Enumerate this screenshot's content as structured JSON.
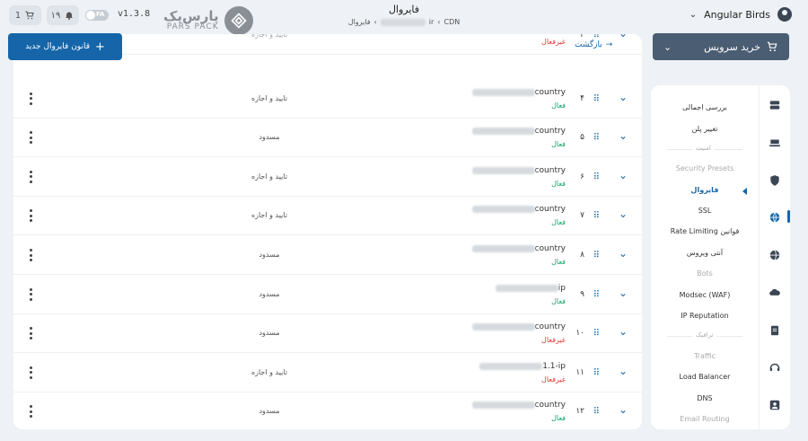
{
  "topbar": {
    "cart_count": "1",
    "notifications_count": "۱۹",
    "lang_label": "FA",
    "version": "v1.3.8",
    "brand_fa": "پارس‌پک",
    "brand_en": "PARS PACK",
    "page_title": "فایروال",
    "breadcrumb": {
      "cdn": "CDN",
      "domain_suffix": "ir",
      "current": "فایروال"
    },
    "account_name": "Angular Birds"
  },
  "actions": {
    "add_rule_label": "قانون فایروال جدید",
    "back_label": "بازگشت",
    "buy_service_label": "خرید سرویس"
  },
  "rules": [
    {
      "num": "۳",
      "name_suffix": "allow-Czech Republic country",
      "status": "غیرفعال",
      "status_type": "inactive",
      "action": "تایید و اجازه",
      "faded": true
    },
    {
      "num": "۴",
      "name_suffix": "country",
      "status": "فعال",
      "status_type": "active",
      "action": "تایید و اجازه"
    },
    {
      "num": "۵",
      "name_suffix": "country",
      "status": "فعال",
      "status_type": "active",
      "action": "مسدود"
    },
    {
      "num": "۶",
      "name_suffix": "country",
      "status": "فعال",
      "status_type": "active",
      "action": "تایید و اجازه"
    },
    {
      "num": "۷",
      "name_suffix": "country",
      "status": "فعال",
      "status_type": "active",
      "action": "تایید و اجازه"
    },
    {
      "num": "۸",
      "name_suffix": "country",
      "status": "فعال",
      "status_type": "active",
      "action": "مسدود"
    },
    {
      "num": "۹",
      "name_suffix": "ip",
      "status": "فعال",
      "status_type": "active",
      "action": "مسدود"
    },
    {
      "num": "۱۰",
      "name_suffix": "country",
      "status": "غیرفعال",
      "status_type": "inactive",
      "action": "مسدود"
    },
    {
      "num": "۱۱",
      "name_suffix": "1.1-ip",
      "status": "غیرفعال",
      "status_type": "inactive",
      "action": "تایید و اجازه"
    },
    {
      "num": "۱۲",
      "name_suffix": "country",
      "status": "فعال",
      "status_type": "active",
      "action": "مسدود"
    }
  ],
  "menu": {
    "overview": "بررسی اجمالی",
    "change_plan": "تغییر پلن",
    "security_section": "امنیت",
    "security_presets": "Security Presets",
    "firewall": "فایروال",
    "ssl": "SSL",
    "rate_limiting": "Rate Limiting قوانین",
    "antivirus": "آنتی ویروس",
    "bots": "Bots",
    "modsec": "Modsec (WAF)",
    "ip_reputation": "IP Reputation",
    "traffic_section": "ترافیک",
    "traffic": "Traffic",
    "load_balancer": "Load Balancer",
    "dns": "DNS",
    "email_routing": "Email Routing"
  },
  "colors": {
    "primary": "#1565a8",
    "active_green": "#17a36b",
    "inactive_red": "#e53935",
    "buy_button": "#4a5d72"
  }
}
